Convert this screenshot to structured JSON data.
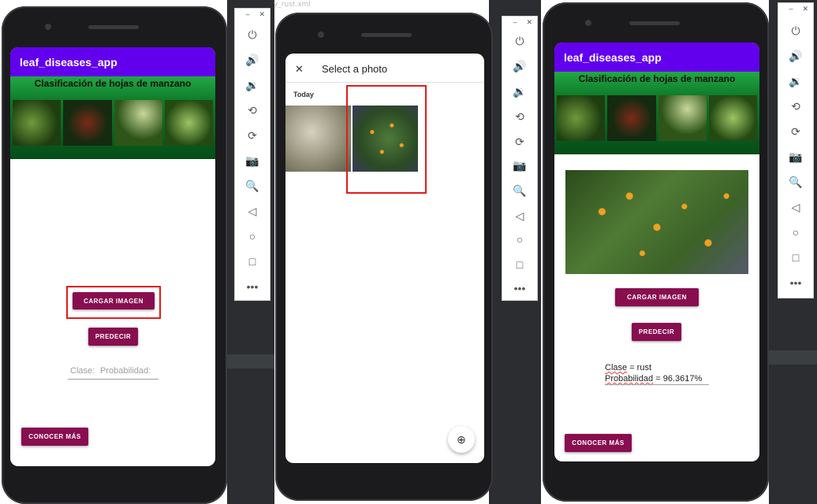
{
  "app": {
    "title": "leaf_diseases_app",
    "banner_title": "Clasificación de hojas de manzano"
  },
  "ide": {
    "tab_label": "y_rust.xml"
  },
  "buttons": {
    "load": "CARGAR IMAGEN",
    "predict": "PREDECIR",
    "learn_more": "CONOCER MÁS"
  },
  "panel1": {
    "placeholder_class": "Clase:",
    "placeholder_prob": "Probabilidad:"
  },
  "picker": {
    "title": "Select a photo",
    "section": "Today",
    "close_symbol": "✕",
    "zoom_symbol": "⊕"
  },
  "result": {
    "class_label": "Clase",
    "class_value": "= rust",
    "prob_label": "Probabilidad",
    "prob_value": "= 96.3617%"
  },
  "emulator": {
    "minimize": "–",
    "close": "✕",
    "icons": [
      "power-icon",
      "volume-up-icon",
      "volume-down-icon",
      "rotate-left-icon",
      "rotate-right-icon",
      "camera-icon",
      "zoom-icon",
      "back-icon",
      "home-icon",
      "overview-icon",
      "more-icon"
    ],
    "glyphs": [
      "⏻",
      "🔊",
      "🔉",
      "⟲",
      "⟳",
      "📷",
      "🔍",
      "◁",
      "○",
      "□",
      "•••"
    ]
  },
  "colors": {
    "appbar": "#6200ee",
    "button": "#880e4f",
    "highlight": "#e21b1b"
  }
}
